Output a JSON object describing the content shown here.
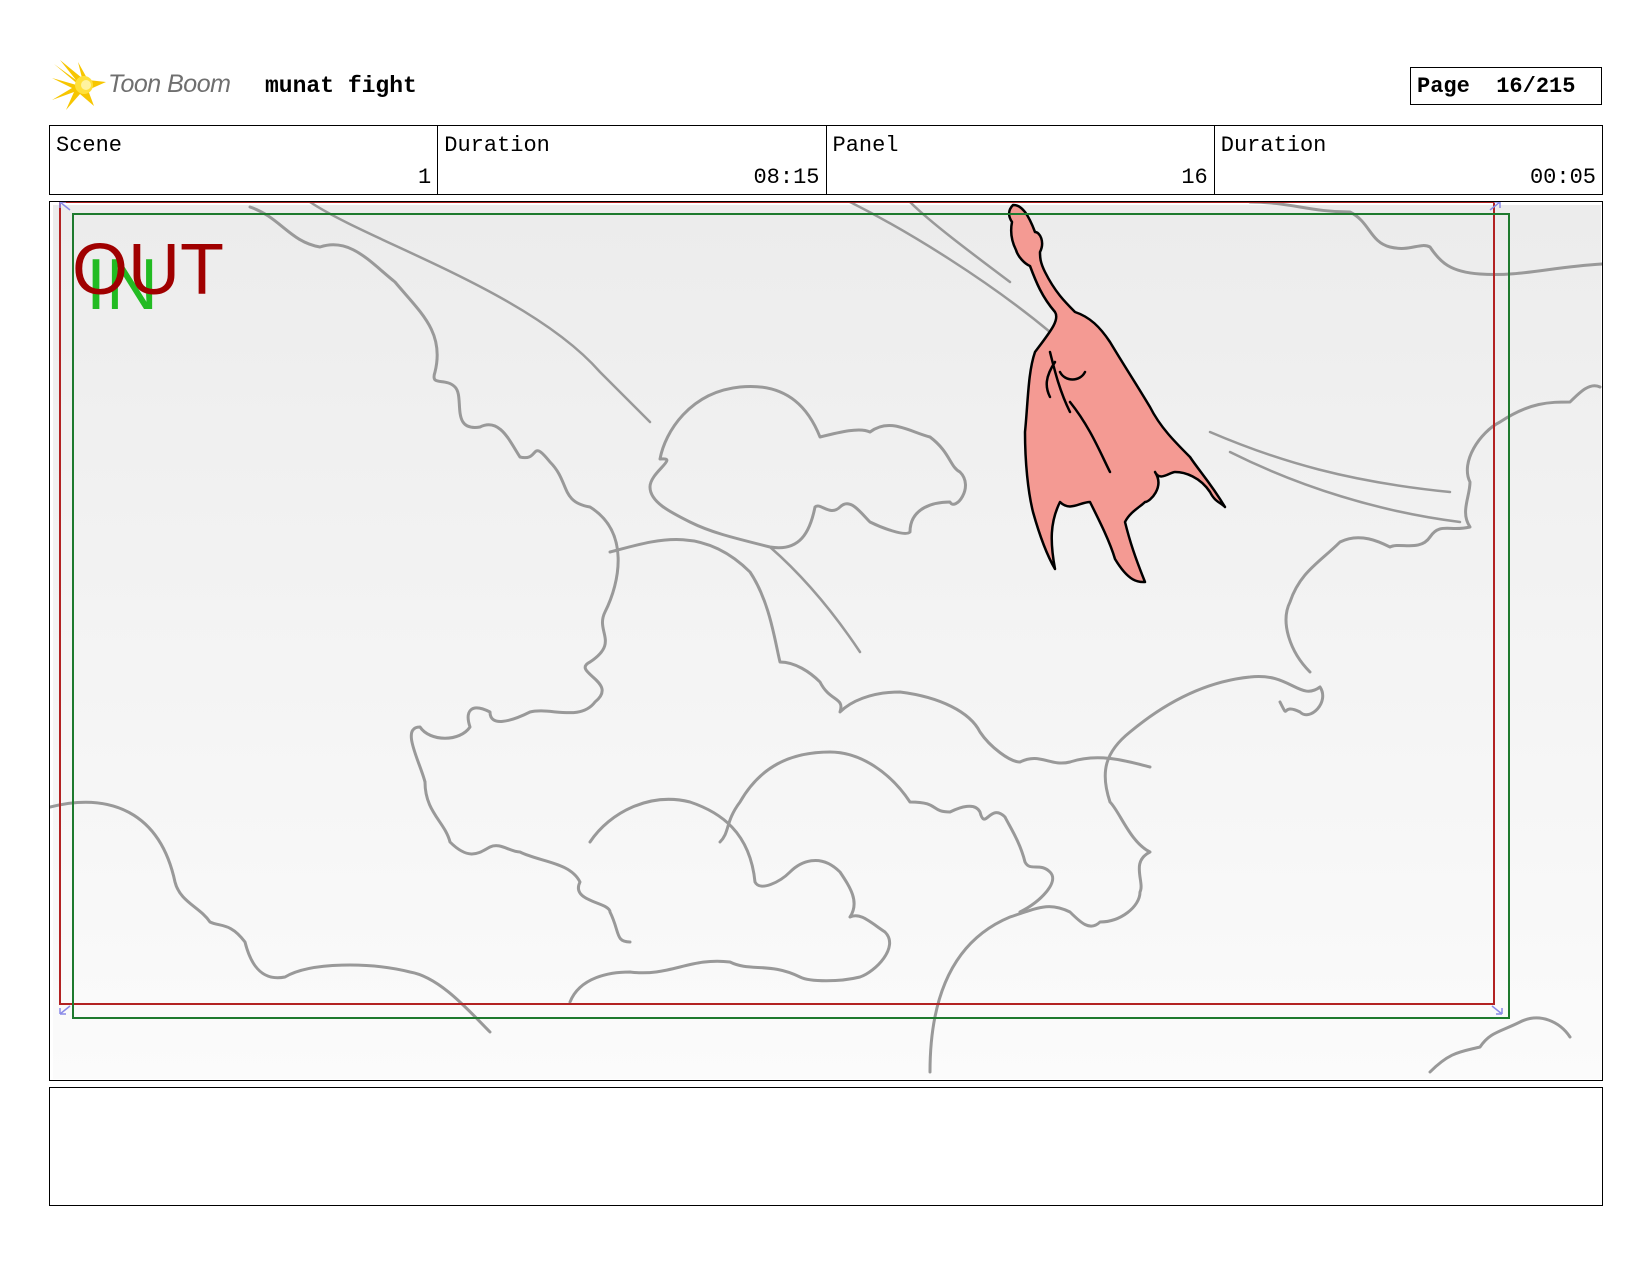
{
  "header": {
    "logo_text": "Toon Boom",
    "project_title": "munat fight",
    "page_label": "Page",
    "page_value": "16/215"
  },
  "info": {
    "scene_label": "Scene",
    "scene_value": "1",
    "scene_duration_label": "Duration",
    "scene_duration_value": "08:15",
    "panel_label": "Panel",
    "panel_value": "16",
    "panel_duration_label": "Duration",
    "panel_duration_value": "00:05"
  },
  "panel": {
    "safe_area_labels": {
      "out": "OUT",
      "in": "IN"
    },
    "colors": {
      "out_frame": "#b22222",
      "in_frame": "#1e7a2e",
      "out_text": "#a00000",
      "in_text": "#22bb22",
      "dragon_fill": "#f49a93",
      "cloud_stroke": "#999999"
    },
    "icons": [
      "cloud-sketch",
      "dragon-drawing",
      "corner-arrow-icon"
    ]
  },
  "notes": {
    "text": ""
  }
}
